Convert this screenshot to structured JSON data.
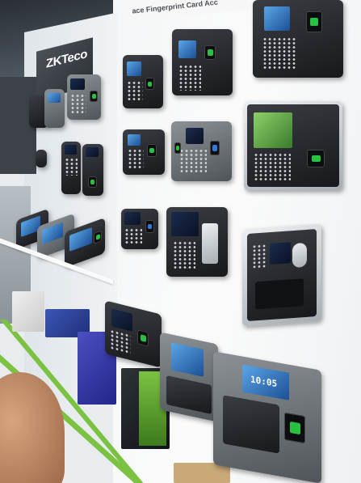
{
  "scene": {
    "brand_logo": "ZKTeco",
    "banner_text": "ace Fingerprint Card Acc",
    "clock_readout": "10:05"
  },
  "colors": {
    "accent_green": "#7cc242",
    "wall": "#f4f6f7",
    "device_dark": "#1f2226",
    "fingerprint_led": "#2fe04a"
  },
  "icons": [
    "fingerprint-sensor-icon",
    "keypad-icon"
  ]
}
